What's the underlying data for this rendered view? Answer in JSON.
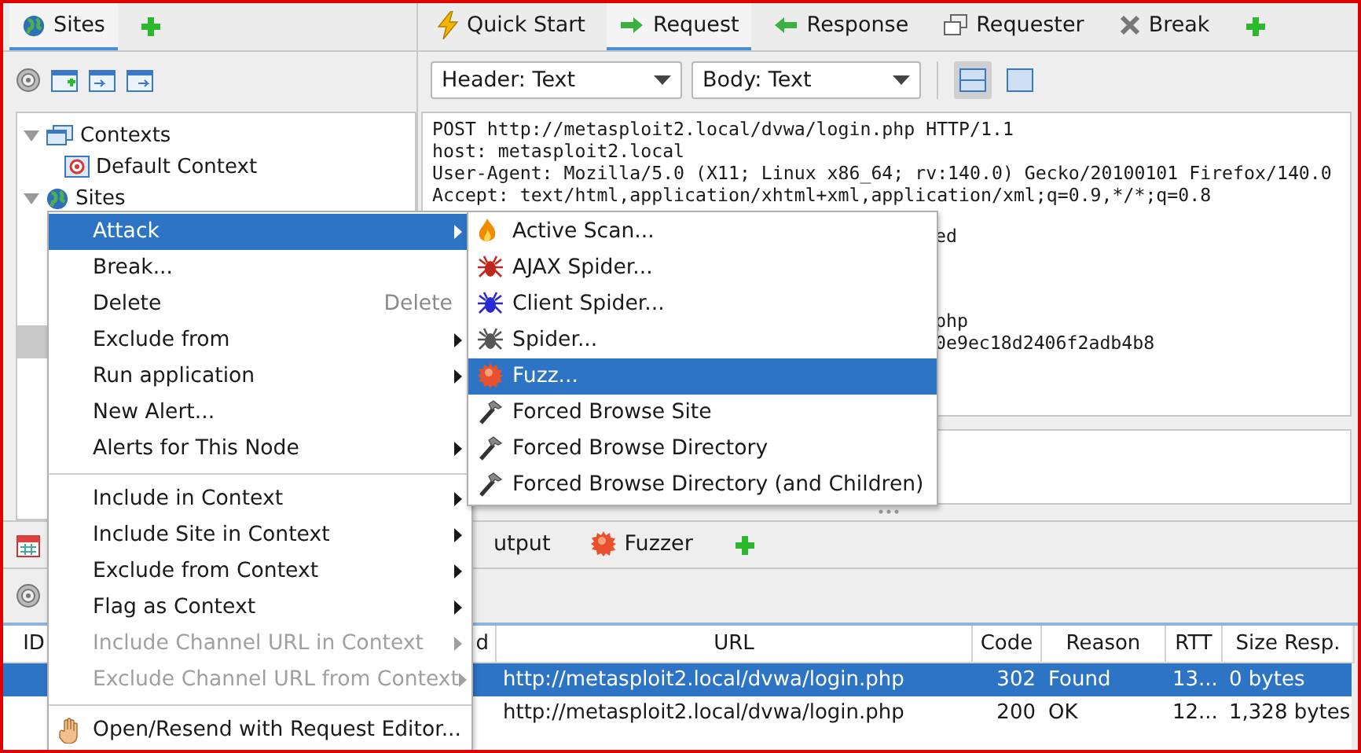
{
  "left_panel": {
    "tabs": [
      {
        "label": "Sites",
        "selected": true
      }
    ],
    "tree": [
      {
        "label": "Contexts",
        "expanded": true,
        "children": [
          {
            "label": "Default Context"
          }
        ]
      },
      {
        "label": "Sites",
        "expanded": true
      }
    ]
  },
  "workspace": {
    "tabs": [
      {
        "label": "Quick Start",
        "selected": false
      },
      {
        "label": "Request",
        "selected": true
      },
      {
        "label": "Response",
        "selected": false
      },
      {
        "label": "Requester",
        "selected": false
      },
      {
        "label": "Break",
        "selected": false
      }
    ],
    "header_select": "Header: Text",
    "body_select": "Body: Text",
    "layout_buttons": [
      {
        "selected": true
      },
      {
        "selected": false
      }
    ],
    "request_lines": [
      "POST http://metasploit2.local/dvwa/login.php HTTP/1.1",
      "host: metasploit2.local",
      "User-Agent: Mozilla/5.0 (X11; Linux x86_64; rv:140.0) Gecko/20100101 Firefox/140.0",
      "Accept: text/html,application/xhtml+xml,application/xml;q=0.9,*/*;q=0.8"
    ],
    "request_tails": [
      "ed",
      "php",
      "0e9ec18d2406f2adb4b8"
    ]
  },
  "bottom_panel": {
    "tabs": [
      {
        "label": "utput",
        "selected": false
      },
      {
        "label": "Fuzzer",
        "selected": false
      }
    ],
    "table": {
      "columns": [
        "ID",
        "d",
        "URL",
        "Code",
        "Reason",
        "RTT",
        "Size Resp."
      ],
      "rows": [
        {
          "selected": true,
          "url": "http://metasploit2.local/dvwa/login.php",
          "code": "302",
          "reason": "Found",
          "rtt": "13...",
          "size": "0 bytes"
        },
        {
          "selected": false,
          "url": "http://metasploit2.local/dvwa/login.php",
          "code": "200",
          "reason": "OK",
          "rtt": "12...",
          "size": "1,328 bytes"
        }
      ]
    }
  },
  "context_menu": {
    "groups": [
      [
        {
          "label": "Attack",
          "submenu": true,
          "selected": true,
          "disabled": false
        },
        {
          "label": "Break...",
          "submenu": false,
          "selected": false,
          "disabled": false
        },
        {
          "label": "Delete",
          "shortcut": "Delete",
          "submenu": false,
          "selected": false,
          "disabled": false
        },
        {
          "label": "Exclude from",
          "submenu": true,
          "selected": false,
          "disabled": false
        },
        {
          "label": "Run application",
          "submenu": true,
          "selected": false,
          "disabled": false
        },
        {
          "label": "New Alert...",
          "submenu": false,
          "selected": false,
          "disabled": false
        },
        {
          "label": "Alerts for This Node",
          "submenu": true,
          "selected": false,
          "disabled": false
        }
      ],
      [
        {
          "label": "Include in Context",
          "submenu": true,
          "selected": false,
          "disabled": false
        },
        {
          "label": "Include Site in Context",
          "submenu": true,
          "selected": false,
          "disabled": false
        },
        {
          "label": "Exclude from Context",
          "submenu": true,
          "selected": false,
          "disabled": false
        },
        {
          "label": "Flag as Context",
          "submenu": true,
          "selected": false,
          "disabled": false
        },
        {
          "label": "Include Channel URL in Context",
          "submenu": true,
          "selected": false,
          "disabled": true
        },
        {
          "label": "Exclude Channel URL from Context",
          "submenu": true,
          "selected": false,
          "disabled": true
        }
      ],
      [
        {
          "label": "Open/Resend with Request Editor...",
          "submenu": false,
          "selected": false,
          "disabled": false
        }
      ]
    ]
  },
  "attack_submenu": [
    {
      "label": "Active Scan...",
      "selected": false
    },
    {
      "label": "AJAX Spider...",
      "color": "#c0281e",
      "selected": false
    },
    {
      "label": "Client Spider...",
      "color": "#2a2ad0",
      "selected": false
    },
    {
      "label": "Spider...",
      "color": "#555555",
      "selected": false
    },
    {
      "label": "Fuzz...",
      "selected": true
    },
    {
      "label": "Forced Browse Site",
      "selected": false
    },
    {
      "label": "Forced Browse Directory",
      "selected": false
    },
    {
      "label": "Forced Browse Directory (and Children)",
      "selected": false
    }
  ]
}
